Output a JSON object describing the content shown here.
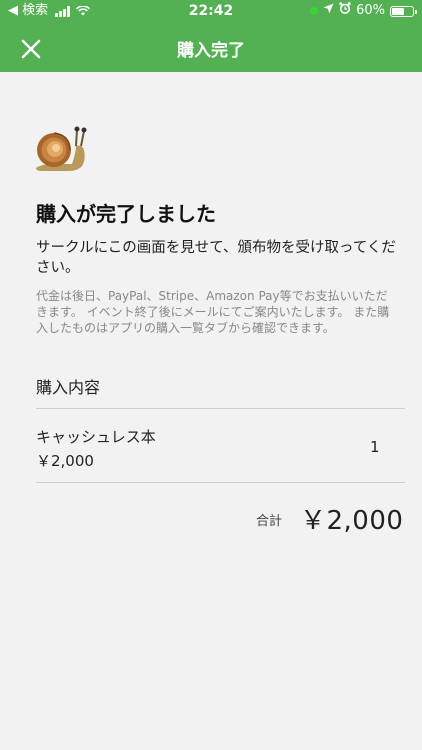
{
  "status_bar": {
    "back_label": "◀ 検索",
    "time": "22:42",
    "battery_text": "60%",
    "battery_level": 0.6
  },
  "nav": {
    "title": "購入完了"
  },
  "main": {
    "heading": "購入が完了しました",
    "lead": "サークルにこの画面を見せて、頒布物を受け取ってください。",
    "note": "代金は後日、PayPal、Stripe、Amazon Pay等でお支払いいただきます。 イベント終了後にメールにてご案内いたします。 また購入したものはアプリの購入一覧タブから確認できます。",
    "section_title": "購入内容"
  },
  "order": {
    "items": [
      {
        "name": "キャッシュレス本",
        "price": "￥2,000",
        "quantity": "1"
      }
    ],
    "total_label": "合計",
    "total_amount": "￥2,000"
  },
  "colors": {
    "accent": "#53b153",
    "background": "#f2f2f2"
  },
  "icons": {
    "close": "close-icon",
    "mascot": "snail-icon"
  }
}
